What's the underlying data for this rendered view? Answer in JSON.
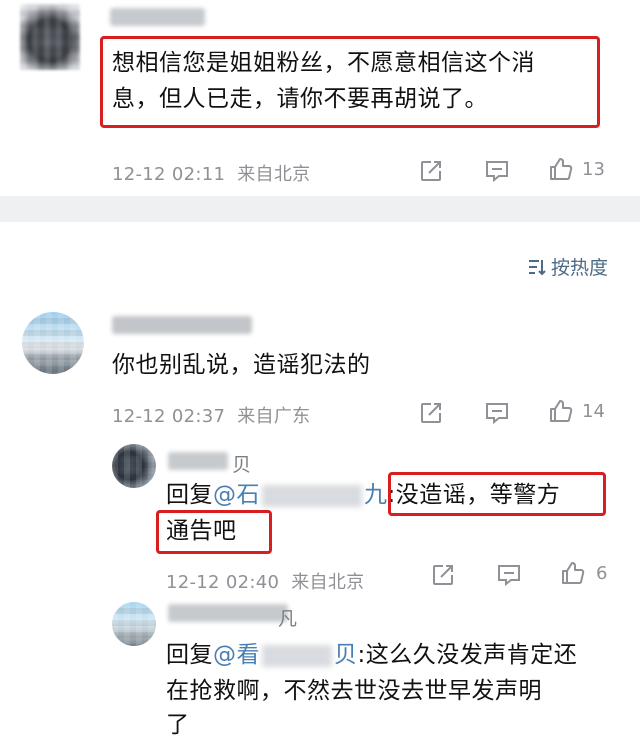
{
  "comment1": {
    "text_line1": "想相信您是姐姐粉丝，不愿意相信这个消",
    "text_line2": "息，但人已走，请你不要再胡说了。",
    "time": "12-12 02:11",
    "location": "来自北京",
    "likes": "13"
  },
  "sort": {
    "label": "按热度"
  },
  "comment2": {
    "text": "你也别乱说，造谣犯法的",
    "time": "12-12 02:37",
    "location": "来自广东",
    "likes": "14"
  },
  "reply1": {
    "name_suffix": "贝",
    "prefix": "回复",
    "mention_start": "@石",
    "mention_end": "九",
    "text_part1": ":没造谣，等警方",
    "text_line2": "通告吧",
    "time": "12-12 02:40",
    "location": "来自北京",
    "likes": "6"
  },
  "reply2": {
    "name_suffix": "凡",
    "prefix": "回复",
    "mention_start": "@看",
    "mention_end": "贝",
    "text_part1": ":这么久没发声肯定还",
    "text_line2": "在抢救啊，不然去世没去世早发声明",
    "text_line3": "了"
  }
}
